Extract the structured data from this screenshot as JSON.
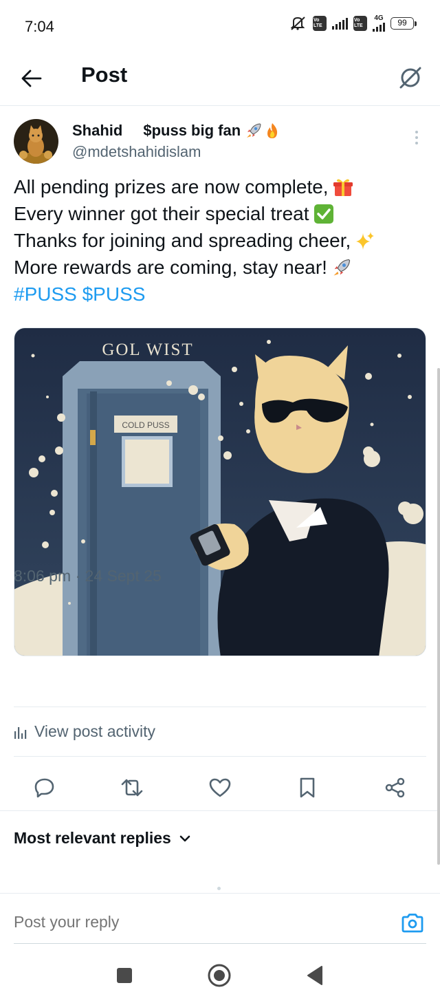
{
  "status_bar": {
    "time": "7:04",
    "volte_1": "Vo LTE",
    "volte_2": "Vo LTE",
    "network": "4G",
    "battery": "99"
  },
  "header": {
    "title": "Post",
    "back_icon": "arrow-left-icon",
    "grok_icon": "grok-icon"
  },
  "post": {
    "author_name": "Shahid",
    "author_name_suffix": "$puss big fan",
    "author_handle": "@mdetshahidislam",
    "text_lines": [
      "All pending prizes are now complete,",
      "Every winner got their special treat",
      "Thanks for joining and spreading cheer,",
      "More rewards are coming, stay near!"
    ],
    "hashtags": "#PUSS $PUSS",
    "image": {
      "banner_text": "GOL WIST",
      "door_sign": "COLD PUSS"
    },
    "timestamp": "8:06 pm · 24 Sept 25",
    "activity_label": "View post activity"
  },
  "actions": {
    "reply_icon": "reply-icon",
    "repost_icon": "repost-icon",
    "like_icon": "heart-icon",
    "bookmark_icon": "bookmark-icon",
    "share_icon": "share-icon"
  },
  "replies": {
    "sort_label": "Most relevant replies"
  },
  "composer": {
    "placeholder": "Post your reply"
  },
  "colors": {
    "accent": "#1d9bf0",
    "text_primary": "#0f1419",
    "text_secondary": "#536471"
  }
}
